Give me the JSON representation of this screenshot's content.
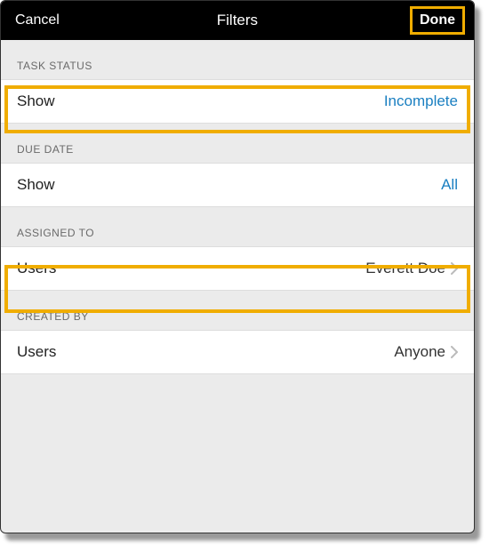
{
  "header": {
    "cancel_label": "Cancel",
    "title": "Filters",
    "done_label": "Done"
  },
  "sections": {
    "task_status": {
      "header": "TASK STATUS",
      "label": "Show",
      "value": "Incomplete"
    },
    "due_date": {
      "header": "DUE DATE",
      "label": "Show",
      "value": "All"
    },
    "assigned_to": {
      "header": "ASSIGNED TO",
      "label": "Users",
      "value": "Everett Doe"
    },
    "created_by": {
      "header": "CREATED BY",
      "label": "Users",
      "value": "Anyone"
    }
  }
}
